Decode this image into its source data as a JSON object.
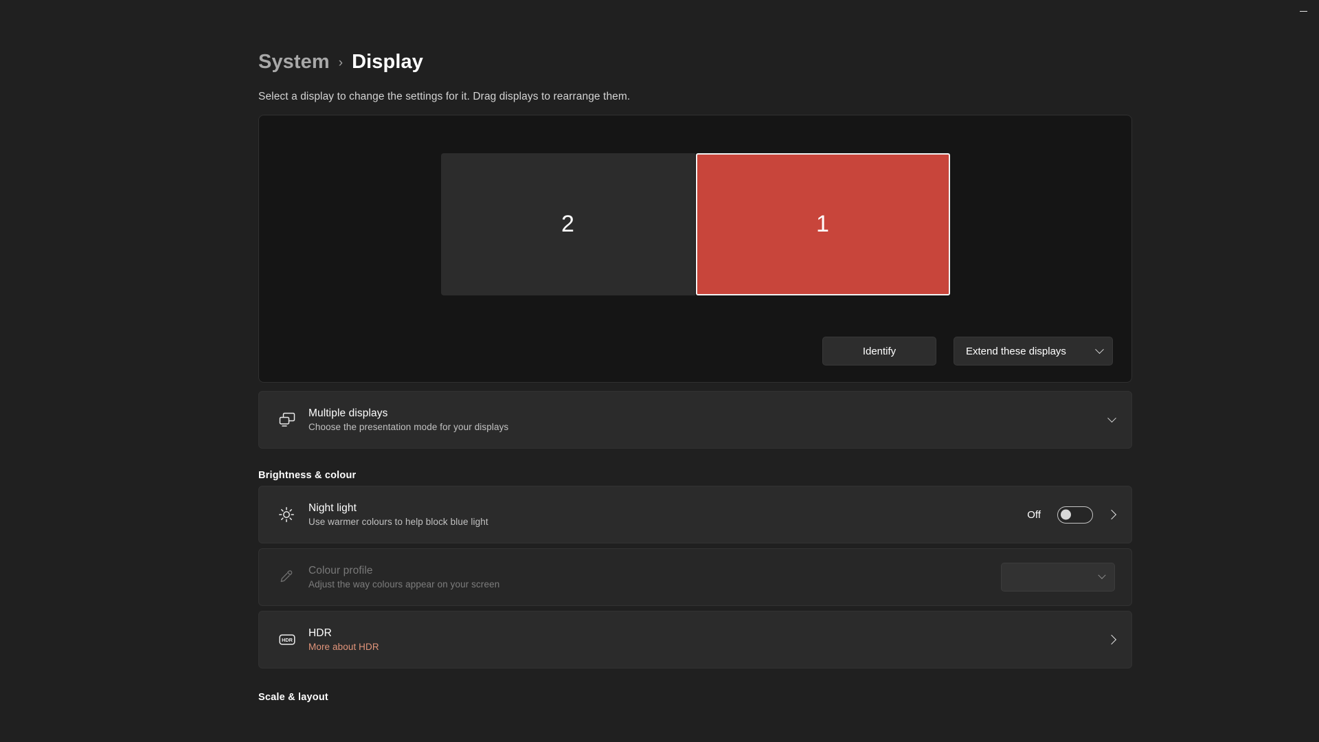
{
  "window": {
    "minimize_label": "Minimize"
  },
  "header": {
    "breadcrumb_parent": "System",
    "breadcrumb_separator": "›",
    "breadcrumb_current": "Display",
    "description": "Select a display to change the settings for it. Drag displays to rearrange them."
  },
  "arrangement": {
    "displays": [
      {
        "number": "2",
        "selected": false
      },
      {
        "number": "1",
        "selected": true
      }
    ],
    "identify_label": "Identify",
    "mode_value": "Extend these displays",
    "selected_color": "#c8453b",
    "unselected_color": "#2c2c2c"
  },
  "multiple_displays": {
    "title": "Multiple displays",
    "subtitle": "Choose the presentation mode for your displays",
    "icon": "multiple-displays-icon"
  },
  "sections": {
    "brightness_colour": "Brightness & colour",
    "scale_layout": "Scale & layout"
  },
  "night_light": {
    "title": "Night light",
    "subtitle": "Use warmer colours to help block blue light",
    "toggle_state": "Off",
    "icon": "brightness-sun-icon"
  },
  "colour_profile": {
    "title": "Colour profile",
    "subtitle": "Adjust the way colours appear on your screen",
    "selected_value": "",
    "disabled": true,
    "icon": "eyedropper-icon"
  },
  "hdr": {
    "title": "HDR",
    "link_label": "More about HDR",
    "link_color": "#e2957b",
    "icon": "hdr-icon"
  }
}
